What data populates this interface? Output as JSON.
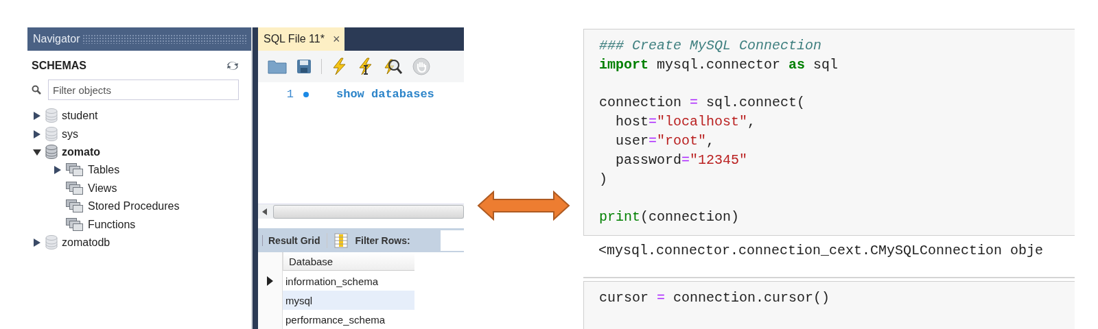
{
  "navigator": {
    "title": "Navigator",
    "section": "SCHEMAS",
    "filter": {
      "placeholder": "Filter objects"
    },
    "schemas": [
      {
        "label": "student",
        "expanded": false,
        "default": false
      },
      {
        "label": "sys",
        "expanded": false,
        "default": false
      },
      {
        "label": "zomato",
        "expanded": true,
        "default": true,
        "children": [
          {
            "label": "Tables",
            "expandable": true
          },
          {
            "label": "Views",
            "expandable": false
          },
          {
            "label": "Stored Procedures",
            "expandable": false
          },
          {
            "label": "Functions",
            "expandable": false
          }
        ]
      },
      {
        "label": "zomatodb",
        "expanded": false,
        "default": false
      }
    ]
  },
  "editor": {
    "tab": {
      "label": "SQL File 11*",
      "close": "×",
      "selected": true
    },
    "lines": [
      {
        "number": "1",
        "text": "show databases"
      }
    ],
    "results": {
      "tab": "Result Grid",
      "filter_label": "Filter Rows:",
      "column": "Database",
      "rows": [
        {
          "value": "information_schema",
          "current": true,
          "selected": false
        },
        {
          "value": "mysql",
          "current": false,
          "selected": true
        },
        {
          "value": "performance_schema",
          "current": false,
          "selected": false
        }
      ]
    }
  },
  "notebook": {
    "cells": [
      {
        "groups": [
          [
            [
              {
                "kind": "comment",
                "text": "### Create MySQL Connection"
              }
            ],
            [
              {
                "kind": "keyword",
                "text": "import"
              },
              {
                "kind": "plain",
                "text": " mysql.connector "
              },
              {
                "kind": "keyword",
                "text": "as"
              },
              {
                "kind": "plain",
                "text": " sql"
              }
            ]
          ],
          [
            [
              {
                "kind": "plain",
                "text": "connection "
              },
              {
                "kind": "op",
                "text": "="
              },
              {
                "kind": "plain",
                "text": " sql.connect("
              }
            ],
            [
              {
                "kind": "plain",
                "text": "  host"
              },
              {
                "kind": "op",
                "text": "="
              },
              {
                "kind": "string",
                "text": "\"localhost\""
              },
              {
                "kind": "plain",
                "text": ","
              }
            ],
            [
              {
                "kind": "plain",
                "text": "  user"
              },
              {
                "kind": "op",
                "text": "="
              },
              {
                "kind": "string",
                "text": "\"root\""
              },
              {
                "kind": "plain",
                "text": ","
              }
            ],
            [
              {
                "kind": "plain",
                "text": "  password"
              },
              {
                "kind": "op",
                "text": "="
              },
              {
                "kind": "string",
                "text": "\"12345\""
              }
            ],
            [
              {
                "kind": "plain",
                "text": ")"
              }
            ]
          ],
          [
            [
              {
                "kind": "builtin",
                "text": "print"
              },
              {
                "kind": "plain",
                "text": "(connection)"
              }
            ]
          ]
        ],
        "output": "<mysql.connector.connection_cext.CMySQLConnection obje"
      },
      {
        "groups": [
          [
            [
              {
                "kind": "plain",
                "text": "cursor "
              },
              {
                "kind": "op",
                "text": "="
              },
              {
                "kind": "plain",
                "text": " connection.cursor()"
              }
            ]
          ]
        ]
      }
    ]
  }
}
